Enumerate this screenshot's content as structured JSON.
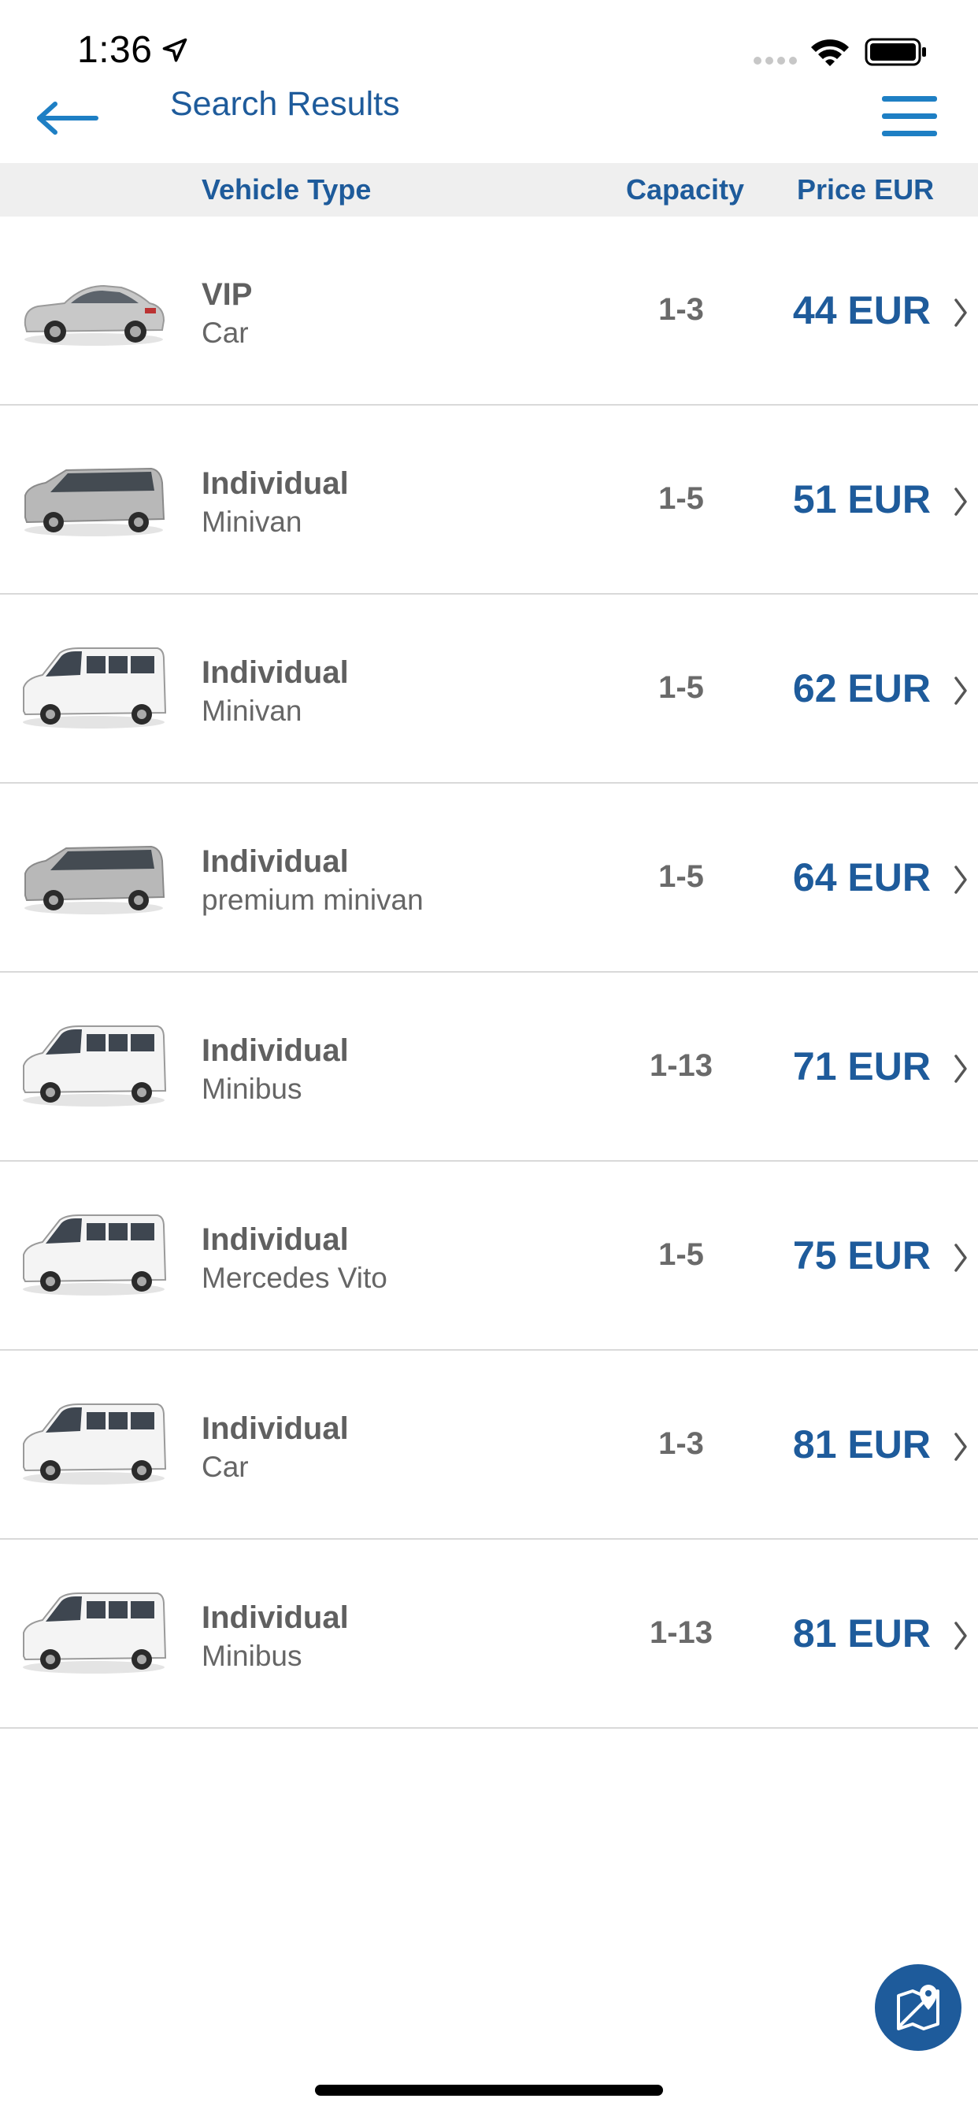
{
  "status_bar": {
    "time": "1:36"
  },
  "nav": {
    "title": "Search Results",
    "back_icon": "back-arrow-icon",
    "menu_icon": "hamburger-menu-icon"
  },
  "table": {
    "headers": {
      "vehicle_type": "Vehicle Type",
      "capacity": "Capacity",
      "price": "Price EUR"
    },
    "rows": [
      {
        "category": "VIP",
        "subtype": "Car",
        "capacity": "1-3",
        "price": "44 EUR",
        "image": "sedan"
      },
      {
        "category": "Individual",
        "subtype": "Minivan",
        "capacity": "1-5",
        "price": "51 EUR",
        "image": "minivan"
      },
      {
        "category": "Individual",
        "subtype": "Minivan",
        "capacity": "1-5",
        "price": "62 EUR",
        "image": "van"
      },
      {
        "category": "Individual",
        "subtype": "premium minivan",
        "capacity": "1-5",
        "price": "64 EUR",
        "image": "minivan"
      },
      {
        "category": "Individual",
        "subtype": "Minibus",
        "capacity": "1-13",
        "price": "71 EUR",
        "image": "van"
      },
      {
        "category": "Individual",
        "subtype": "Mercedes Vito",
        "capacity": "1-5",
        "price": "75 EUR",
        "image": "van"
      },
      {
        "category": "Individual",
        "subtype": "Car",
        "capacity": "1-3",
        "price": "81 EUR",
        "image": "van"
      },
      {
        "category": "Individual",
        "subtype": "Minibus",
        "capacity": "1-13",
        "price": "81 EUR",
        "image": "van"
      }
    ]
  },
  "fab": {
    "icon": "map-location-icon"
  },
  "colors": {
    "accent": "#1e5b9b",
    "header_bg": "#efefef",
    "text_gray": "#606060"
  }
}
